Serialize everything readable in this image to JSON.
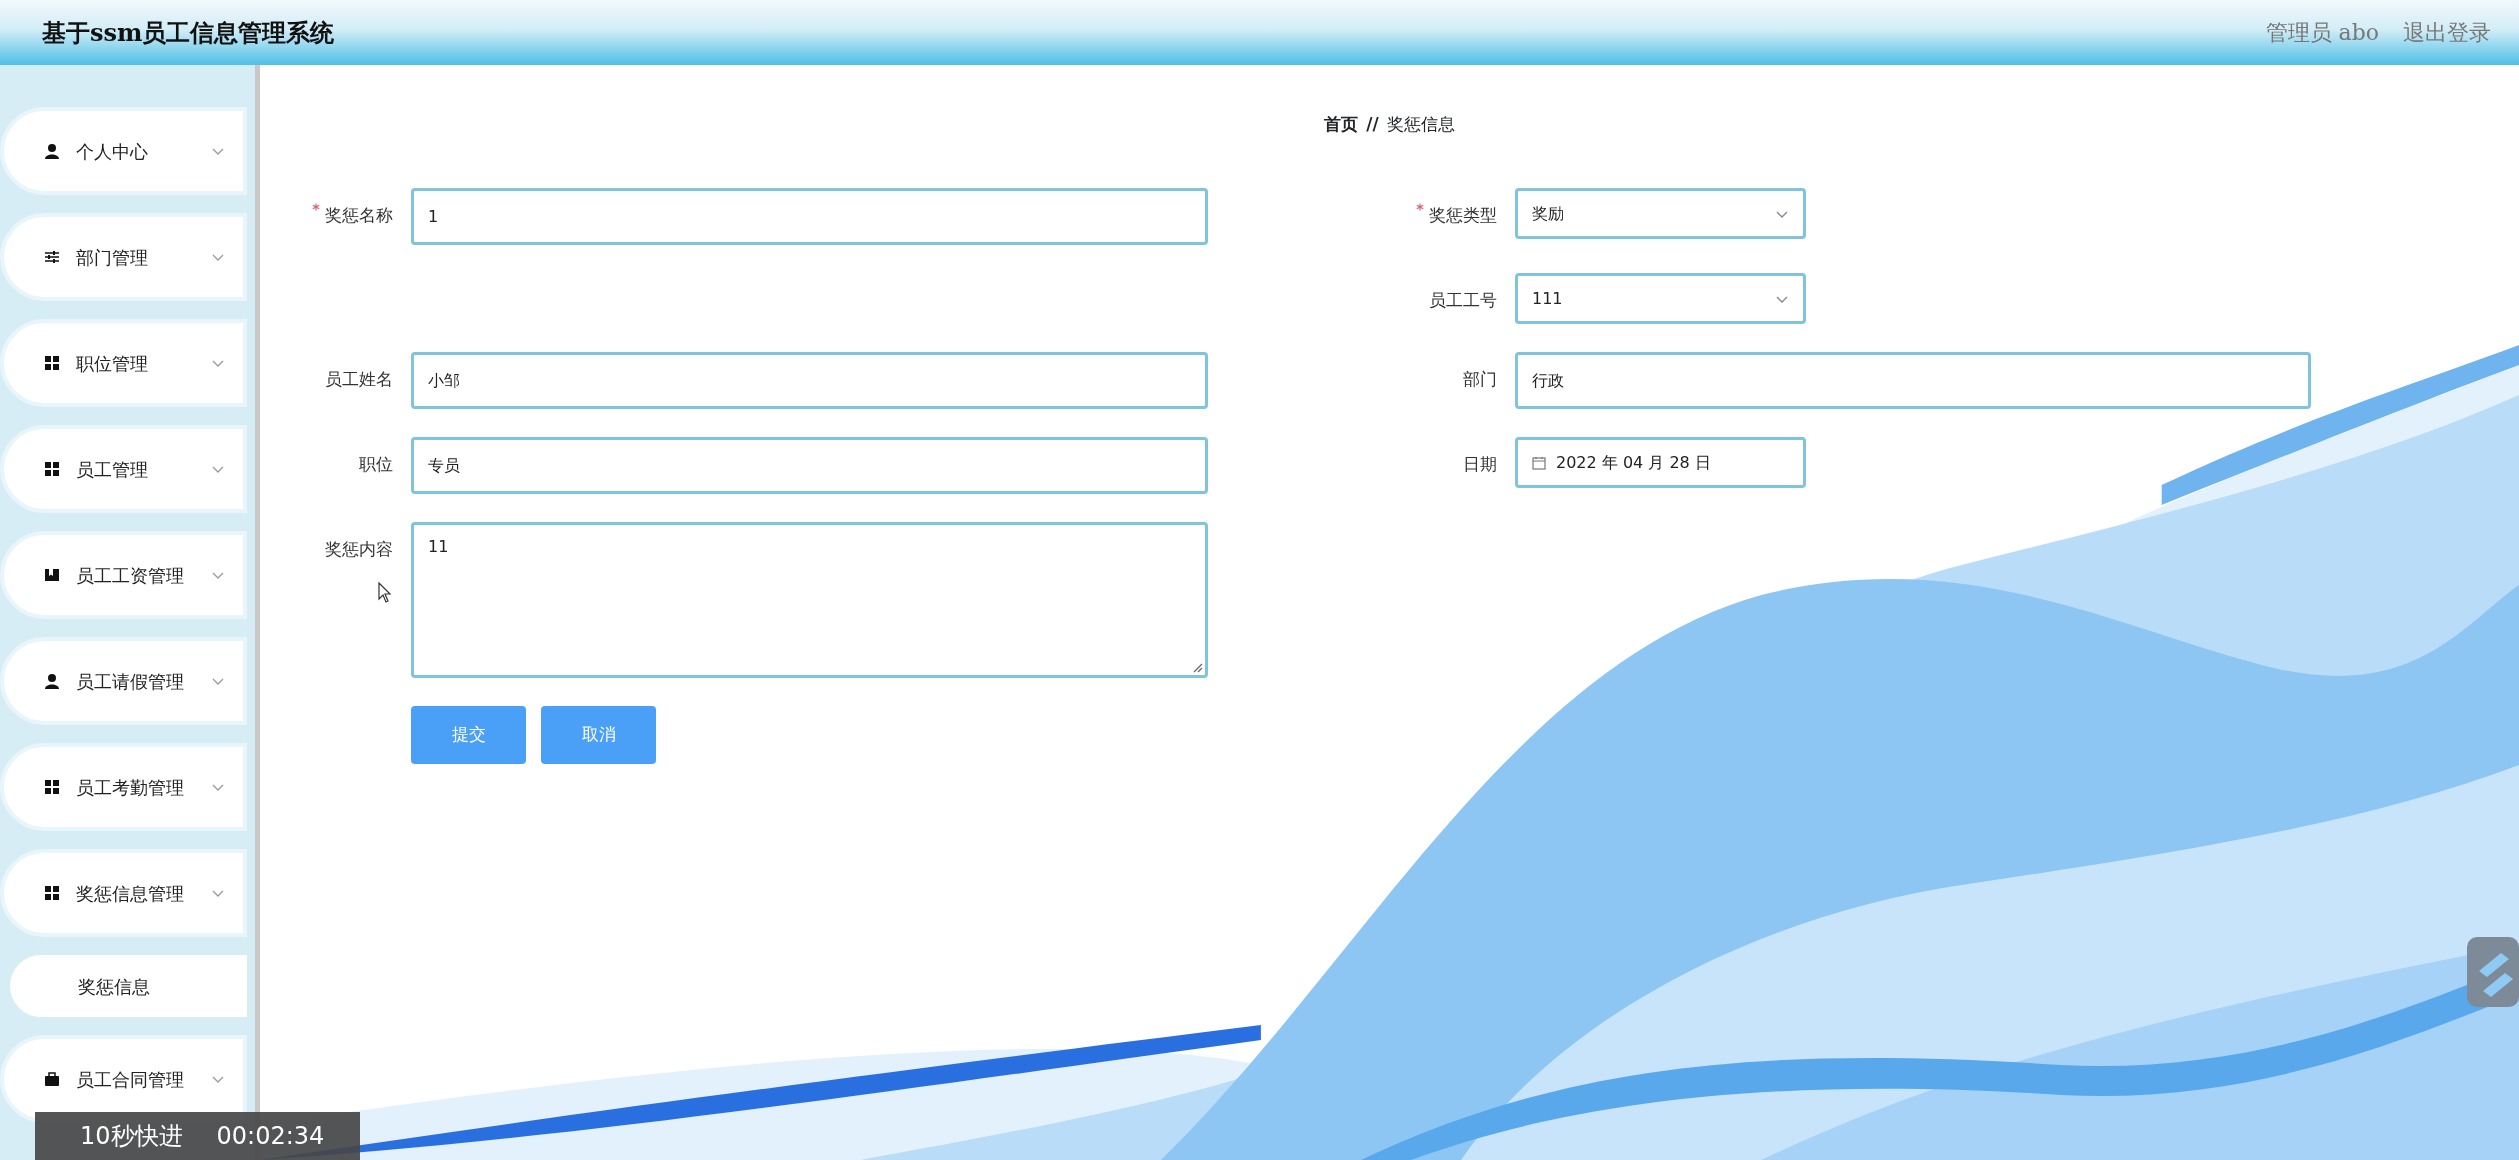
{
  "header": {
    "title": "基于ssm员工信息管理系统",
    "user": "管理员 abo",
    "logout": "退出登录"
  },
  "sidebar": {
    "items": [
      {
        "label": "个人中心",
        "kind": "user"
      },
      {
        "label": "部门管理",
        "kind": "sliders"
      },
      {
        "label": "职位管理",
        "kind": "grid"
      },
      {
        "label": "员工管理",
        "kind": "grid"
      },
      {
        "label": "员工工资管理",
        "kind": "book"
      },
      {
        "label": "员工请假管理",
        "kind": "user"
      },
      {
        "label": "员工考勤管理",
        "kind": "grid"
      },
      {
        "label": "奖惩信息管理",
        "kind": "grid",
        "children": [
          {
            "label": "奖惩信息"
          }
        ]
      },
      {
        "label": "员工合同管理",
        "kind": "briefcase"
      }
    ]
  },
  "breadcrumb": {
    "home": "首页",
    "separator": "//",
    "current": "奖惩信息"
  },
  "form": {
    "rows": [
      {
        "left": {
          "label": "奖惩名称",
          "kind": "text",
          "value": "1",
          "required": true
        },
        "right": {
          "label": "奖惩类型",
          "kind": "select",
          "value": "奖励",
          "required": true
        }
      },
      {
        "right": {
          "label": "员工工号",
          "kind": "select",
          "value": "111",
          "required": false
        }
      },
      {
        "left": {
          "label": "员工姓名",
          "kind": "text",
          "value": "小邹",
          "required": false
        },
        "right": {
          "label": "部门",
          "kind": "text",
          "value": "行政",
          "required": false
        }
      },
      {
        "left": {
          "label": "职位",
          "kind": "text",
          "value": "专员",
          "required": false
        },
        "right": {
          "label": "日期",
          "kind": "date",
          "value": "2022 年 04 月 28 日",
          "required": false
        }
      },
      {
        "left": {
          "label": "奖惩内容",
          "kind": "textarea",
          "value": "11",
          "required": false
        }
      }
    ],
    "buttons": [
      "提交",
      "取消"
    ]
  },
  "player_overlay": {
    "label": "10秒快进",
    "time": "00:02:34"
  }
}
